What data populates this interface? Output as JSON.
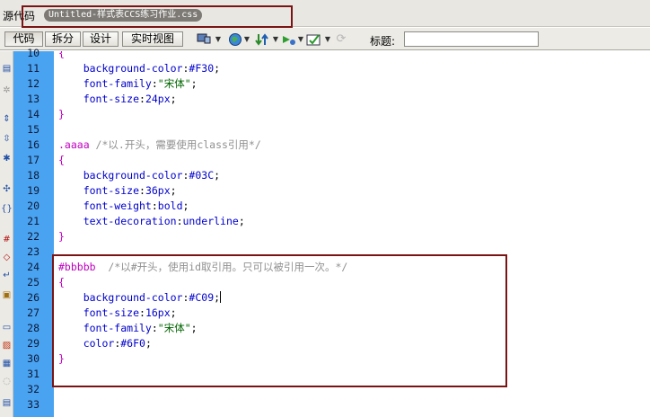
{
  "filebar": {
    "source_label": "源代码",
    "file_tab": "Untitled-样式表CCS练习作业.css"
  },
  "toolbar": {
    "views": [
      "代码",
      "拆分",
      "设计",
      "实时视图"
    ],
    "title_label": "标题:",
    "title_value": "",
    "icons": [
      "multiscreen-icon",
      "globe-icon",
      "file-transfer-icon",
      "debug-icon",
      "validate-icon",
      "refresh-icon"
    ]
  },
  "left_tools": [
    "open-icon",
    "settings-icon",
    "collapse-icon",
    "expand-icon",
    "select-icon",
    "wrap-icon",
    "indent-icon",
    "line-numbers-icon",
    "highlight-icon",
    "syntax-icon",
    "format-icon",
    "comment-icon",
    "snippet-icon",
    "history-icon",
    "format-source-icon",
    "outdent-icon"
  ],
  "gutter": {
    "line_numbers": [
      "10",
      "11",
      "12",
      "13",
      "14",
      "15",
      "16",
      "17",
      "18",
      "19",
      "20",
      "21",
      "22",
      "23",
      "24",
      "25",
      "26",
      "27",
      "28",
      "29",
      "30",
      "31",
      "32",
      "33"
    ]
  },
  "code": {
    "lines": [
      {
        "n": 10,
        "tokens": [
          {
            "t": "{",
            "c": "brace"
          }
        ]
      },
      {
        "n": 11,
        "tokens": [
          {
            "t": "    background-color",
            "c": "prop"
          },
          {
            "t": ":",
            "c": "punc"
          },
          {
            "t": "#F30",
            "c": "val"
          },
          {
            "t": ";",
            "c": "punc"
          }
        ]
      },
      {
        "n": 12,
        "tokens": [
          {
            "t": "    font-family",
            "c": "prop"
          },
          {
            "t": ":",
            "c": "punc"
          },
          {
            "t": "\"宋体\"",
            "c": "str"
          },
          {
            "t": ";",
            "c": "punc"
          }
        ]
      },
      {
        "n": 13,
        "tokens": [
          {
            "t": "    font-size",
            "c": "prop"
          },
          {
            "t": ":",
            "c": "punc"
          },
          {
            "t": "24px",
            "c": "val"
          },
          {
            "t": ";",
            "c": "punc"
          }
        ]
      },
      {
        "n": 14,
        "tokens": [
          {
            "t": "}",
            "c": "brace"
          }
        ]
      },
      {
        "n": 15,
        "tokens": []
      },
      {
        "n": 16,
        "tokens": [
          {
            "t": ".aaaa",
            "c": "sel"
          },
          {
            "t": " /*以.开头，需要使用class引用*/",
            "c": "cmt"
          }
        ]
      },
      {
        "n": 17,
        "tokens": [
          {
            "t": "{",
            "c": "brace"
          }
        ]
      },
      {
        "n": 18,
        "tokens": [
          {
            "t": "    background-color",
            "c": "prop"
          },
          {
            "t": ":",
            "c": "punc"
          },
          {
            "t": "#03C",
            "c": "val"
          },
          {
            "t": ";",
            "c": "punc"
          }
        ]
      },
      {
        "n": 19,
        "tokens": [
          {
            "t": "    font-size",
            "c": "prop"
          },
          {
            "t": ":",
            "c": "punc"
          },
          {
            "t": "36px",
            "c": "val"
          },
          {
            "t": ";",
            "c": "punc"
          }
        ]
      },
      {
        "n": 20,
        "tokens": [
          {
            "t": "    font-weight",
            "c": "prop"
          },
          {
            "t": ":",
            "c": "punc"
          },
          {
            "t": "bold",
            "c": "val"
          },
          {
            "t": ";",
            "c": "punc"
          }
        ]
      },
      {
        "n": 21,
        "tokens": [
          {
            "t": "    text-decoration",
            "c": "prop"
          },
          {
            "t": ":",
            "c": "punc"
          },
          {
            "t": "underline",
            "c": "val"
          },
          {
            "t": ";",
            "c": "punc"
          }
        ]
      },
      {
        "n": 22,
        "tokens": [
          {
            "t": "}",
            "c": "brace"
          }
        ]
      },
      {
        "n": 23,
        "tokens": []
      },
      {
        "n": 24,
        "tokens": [
          {
            "t": "#bbbbb",
            "c": "sel"
          },
          {
            "t": "  /*以#开头，使用id取引用。只可以被引用一次。*/",
            "c": "cmt"
          }
        ]
      },
      {
        "n": 25,
        "tokens": [
          {
            "t": "{",
            "c": "brace"
          }
        ]
      },
      {
        "n": 26,
        "tokens": [
          {
            "t": "    background-color",
            "c": "prop"
          },
          {
            "t": ":",
            "c": "punc"
          },
          {
            "t": "#C09",
            "c": "val"
          },
          {
            "t": ";",
            "c": "punc"
          }
        ],
        "caret": true
      },
      {
        "n": 27,
        "tokens": [
          {
            "t": "    font-size",
            "c": "prop"
          },
          {
            "t": ":",
            "c": "punc"
          },
          {
            "t": "16px",
            "c": "val"
          },
          {
            "t": ";",
            "c": "punc"
          }
        ]
      },
      {
        "n": 28,
        "tokens": [
          {
            "t": "    font-family",
            "c": "prop"
          },
          {
            "t": ":",
            "c": "punc"
          },
          {
            "t": "\"宋体\"",
            "c": "str"
          },
          {
            "t": ";",
            "c": "punc"
          }
        ]
      },
      {
        "n": 29,
        "tokens": [
          {
            "t": "    color",
            "c": "prop"
          },
          {
            "t": ":",
            "c": "punc"
          },
          {
            "t": "#6F0",
            "c": "val"
          },
          {
            "t": ";",
            "c": "punc"
          }
        ]
      },
      {
        "n": 30,
        "tokens": [
          {
            "t": "}",
            "c": "brace"
          }
        ]
      },
      {
        "n": 31,
        "tokens": []
      },
      {
        "n": 32,
        "tokens": []
      },
      {
        "n": 33,
        "tokens": []
      }
    ]
  },
  "colors": {
    "gutter": "#4aa3f0",
    "highlight_border": "#7a1414",
    "selector": "#c000c0",
    "property": "#0000cc",
    "string": "#006600",
    "comment": "#909090"
  }
}
